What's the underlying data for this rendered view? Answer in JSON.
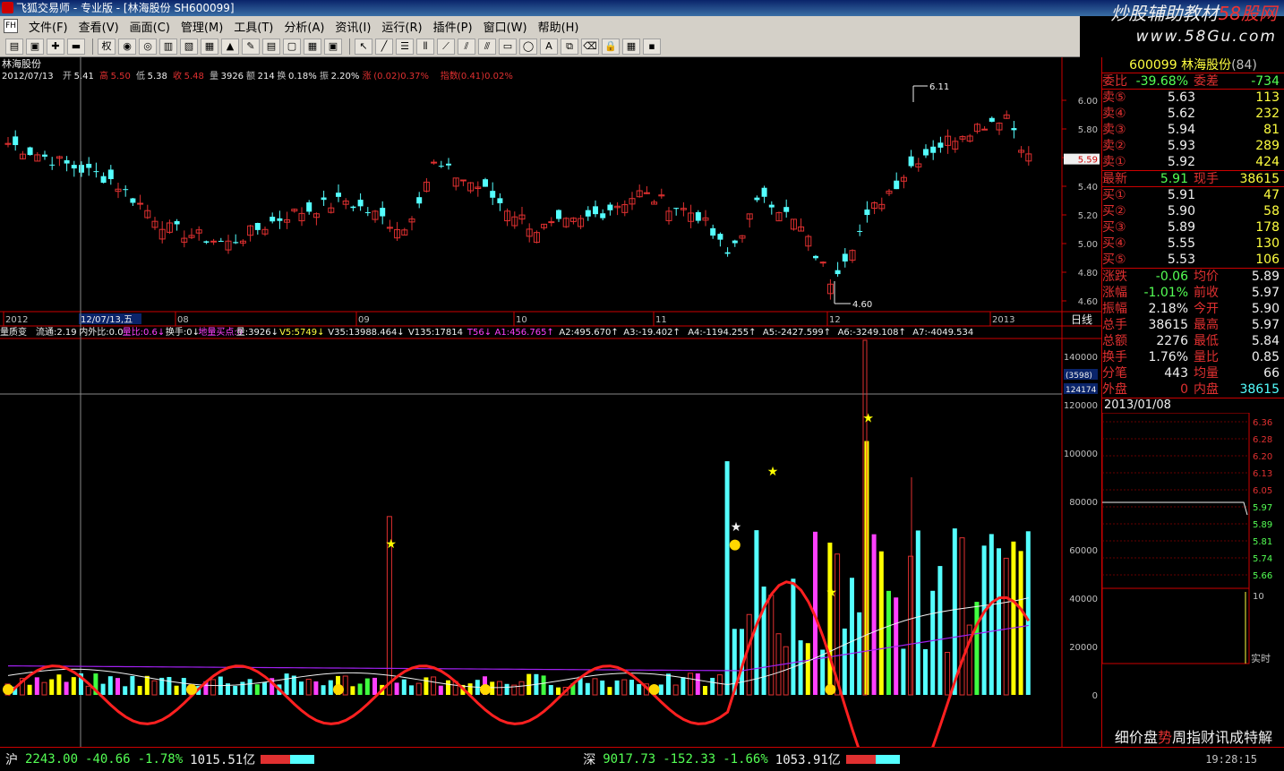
{
  "window": {
    "title": "飞狐交易师 - 专业版 - [林海股份 SH600099]"
  },
  "banner": {
    "line1": "炒股辅助教材",
    "line1_red": "58股网",
    "line2": "www.58Gu.com"
  },
  "menu": [
    "文件(F)",
    "查看(V)",
    "画面(C)",
    "管理(M)",
    "工具(T)",
    "分析(A)",
    "资讯(I)",
    "运行(R)",
    "插件(P)",
    "窗口(W)",
    "帮助(H)"
  ],
  "toolbar": {
    "quan_label": "权"
  },
  "chart_header": {
    "stock_name": "林海股份",
    "date": "2012/07/13",
    "open_k": "开",
    "open_v": "5.41",
    "high_k": "高",
    "high_v": "5.50",
    "low_k": "低",
    "low_v": "5.38",
    "close_k": "收",
    "close_v": "5.48",
    "vol_k": "量",
    "vol_v": "3926",
    "amt_k": "额",
    "amt_v": "214",
    "turn_k": "换",
    "turn_v": "0.18%",
    "amp_k": "振",
    "amp_v": "2.20%",
    "chg_k": "涨",
    "chg_v": "(0.02)0.37%",
    "idx_k": "指数",
    "idx_v": "(0.41)0.02%"
  },
  "price_axis": [
    "6.00",
    "5.80",
    "5.60",
    "5.40",
    "5.20",
    "5.00",
    "4.80",
    "4.60"
  ],
  "price_marker": "5.59",
  "high_label": "6.11",
  "low_label": "4.60",
  "time_axis": {
    "labels": [
      "2012",
      "08",
      "09",
      "10",
      "11",
      "12",
      "2013"
    ],
    "cursor_date": "12/07/13,五",
    "period": "日线"
  },
  "vol_header": {
    "name": "量质变",
    "items": [
      "流通:2.19",
      "内外比:0.0",
      "量比:0.6↓",
      "换手:0↓",
      "地量买点:0",
      "量:3926↓",
      "V5:5749↓",
      "V35:13988.464↓",
      "V135:17814",
      "T56↓",
      "A1:456.765↑",
      "A2:495.670↑",
      "A3:-19.402↑",
      "A4:-1194.255↑",
      "A5:-2427.599↑",
      "A6:-3249.108↑",
      "A7:-4049.534"
    ]
  },
  "vol_axis": [
    "140000",
    "120000",
    "100000",
    "80000",
    "60000",
    "40000",
    "20000",
    "0"
  ],
  "vol_cursor": {
    "a": "(3598)",
    "b": "124174"
  },
  "quote": {
    "code": "600099",
    "name": "林海股份",
    "tag": "(84)",
    "weibi_k": "委比",
    "weibi_v": "-39.68%",
    "weicha_k": "委差",
    "weicha_v": "-734",
    "asks": [
      {
        "label": "卖⑤",
        "price": "5.63",
        "vol": "113"
      },
      {
        "label": "卖④",
        "price": "5.62",
        "vol": "232"
      },
      {
        "label": "卖③",
        "price": "5.94",
        "vol": "81"
      },
      {
        "label": "卖②",
        "price": "5.93",
        "vol": "289"
      },
      {
        "label": "卖①",
        "price": "5.92",
        "vol": "424"
      }
    ],
    "last_k": "最新",
    "last_v": "5.91",
    "now_k": "现手",
    "now_v": "38615",
    "bids": [
      {
        "label": "买①",
        "price": "5.91",
        "vol": "47"
      },
      {
        "label": "买②",
        "price": "5.90",
        "vol": "58"
      },
      {
        "label": "买③",
        "price": "5.89",
        "vol": "178"
      },
      {
        "label": "买④",
        "price": "5.55",
        "vol": "130"
      },
      {
        "label": "买⑤",
        "price": "5.53",
        "vol": "106"
      }
    ],
    "fields": [
      {
        "k1": "涨跌",
        "v1": "-0.06",
        "k2": "均价",
        "v2": "5.89"
      },
      {
        "k1": "涨幅",
        "v1": "-1.01%",
        "k2": "前收",
        "v2": "5.97"
      },
      {
        "k1": "振幅",
        "v1": "2.18%",
        "k2": "今开",
        "v2": "5.90"
      },
      {
        "k1": "总手",
        "v1": "38615",
        "k2": "最高",
        "v2": "5.97"
      },
      {
        "k1": "总额",
        "v1": "2276",
        "k2": "最低",
        "v2": "5.84"
      },
      {
        "k1": "换手",
        "v1": "1.76%",
        "k2": "量比",
        "v2": "0.85"
      },
      {
        "k1": "分笔",
        "v1": "443",
        "k2": "均量",
        "v2": "66"
      },
      {
        "k1": "外盘",
        "v1": "0",
        "k2": "内盘",
        "v2": "38615"
      }
    ],
    "mini_date": "2013/01/08",
    "mini_axis": [
      "6.36",
      "6.28",
      "6.20",
      "6.13",
      "6.05",
      "5.97",
      "5.89",
      "5.81",
      "5.74",
      "5.66"
    ],
    "mini_vol_label": "10",
    "mini_mode": "实时",
    "tabs": [
      "细",
      "价",
      "盘",
      "势",
      "周",
      "指",
      "财",
      "讯",
      "成",
      "特",
      "解"
    ]
  },
  "status": {
    "sh_k": "沪",
    "sh_v": "2243.00",
    "sh_chg": "-40.66",
    "sh_pct": "-1.78%",
    "sh_amt": "1015.51亿",
    "sz_k": "深",
    "sz_v": "9017.73",
    "sz_chg": "-152.33",
    "sz_pct": "-1.66%",
    "sz_amt": "1053.91亿",
    "time": "19:28:15"
  },
  "colors": {
    "up": "#e03030",
    "down": "#54ffff",
    "yellow": "#ffff00",
    "magenta": "#ff40ff"
  }
}
